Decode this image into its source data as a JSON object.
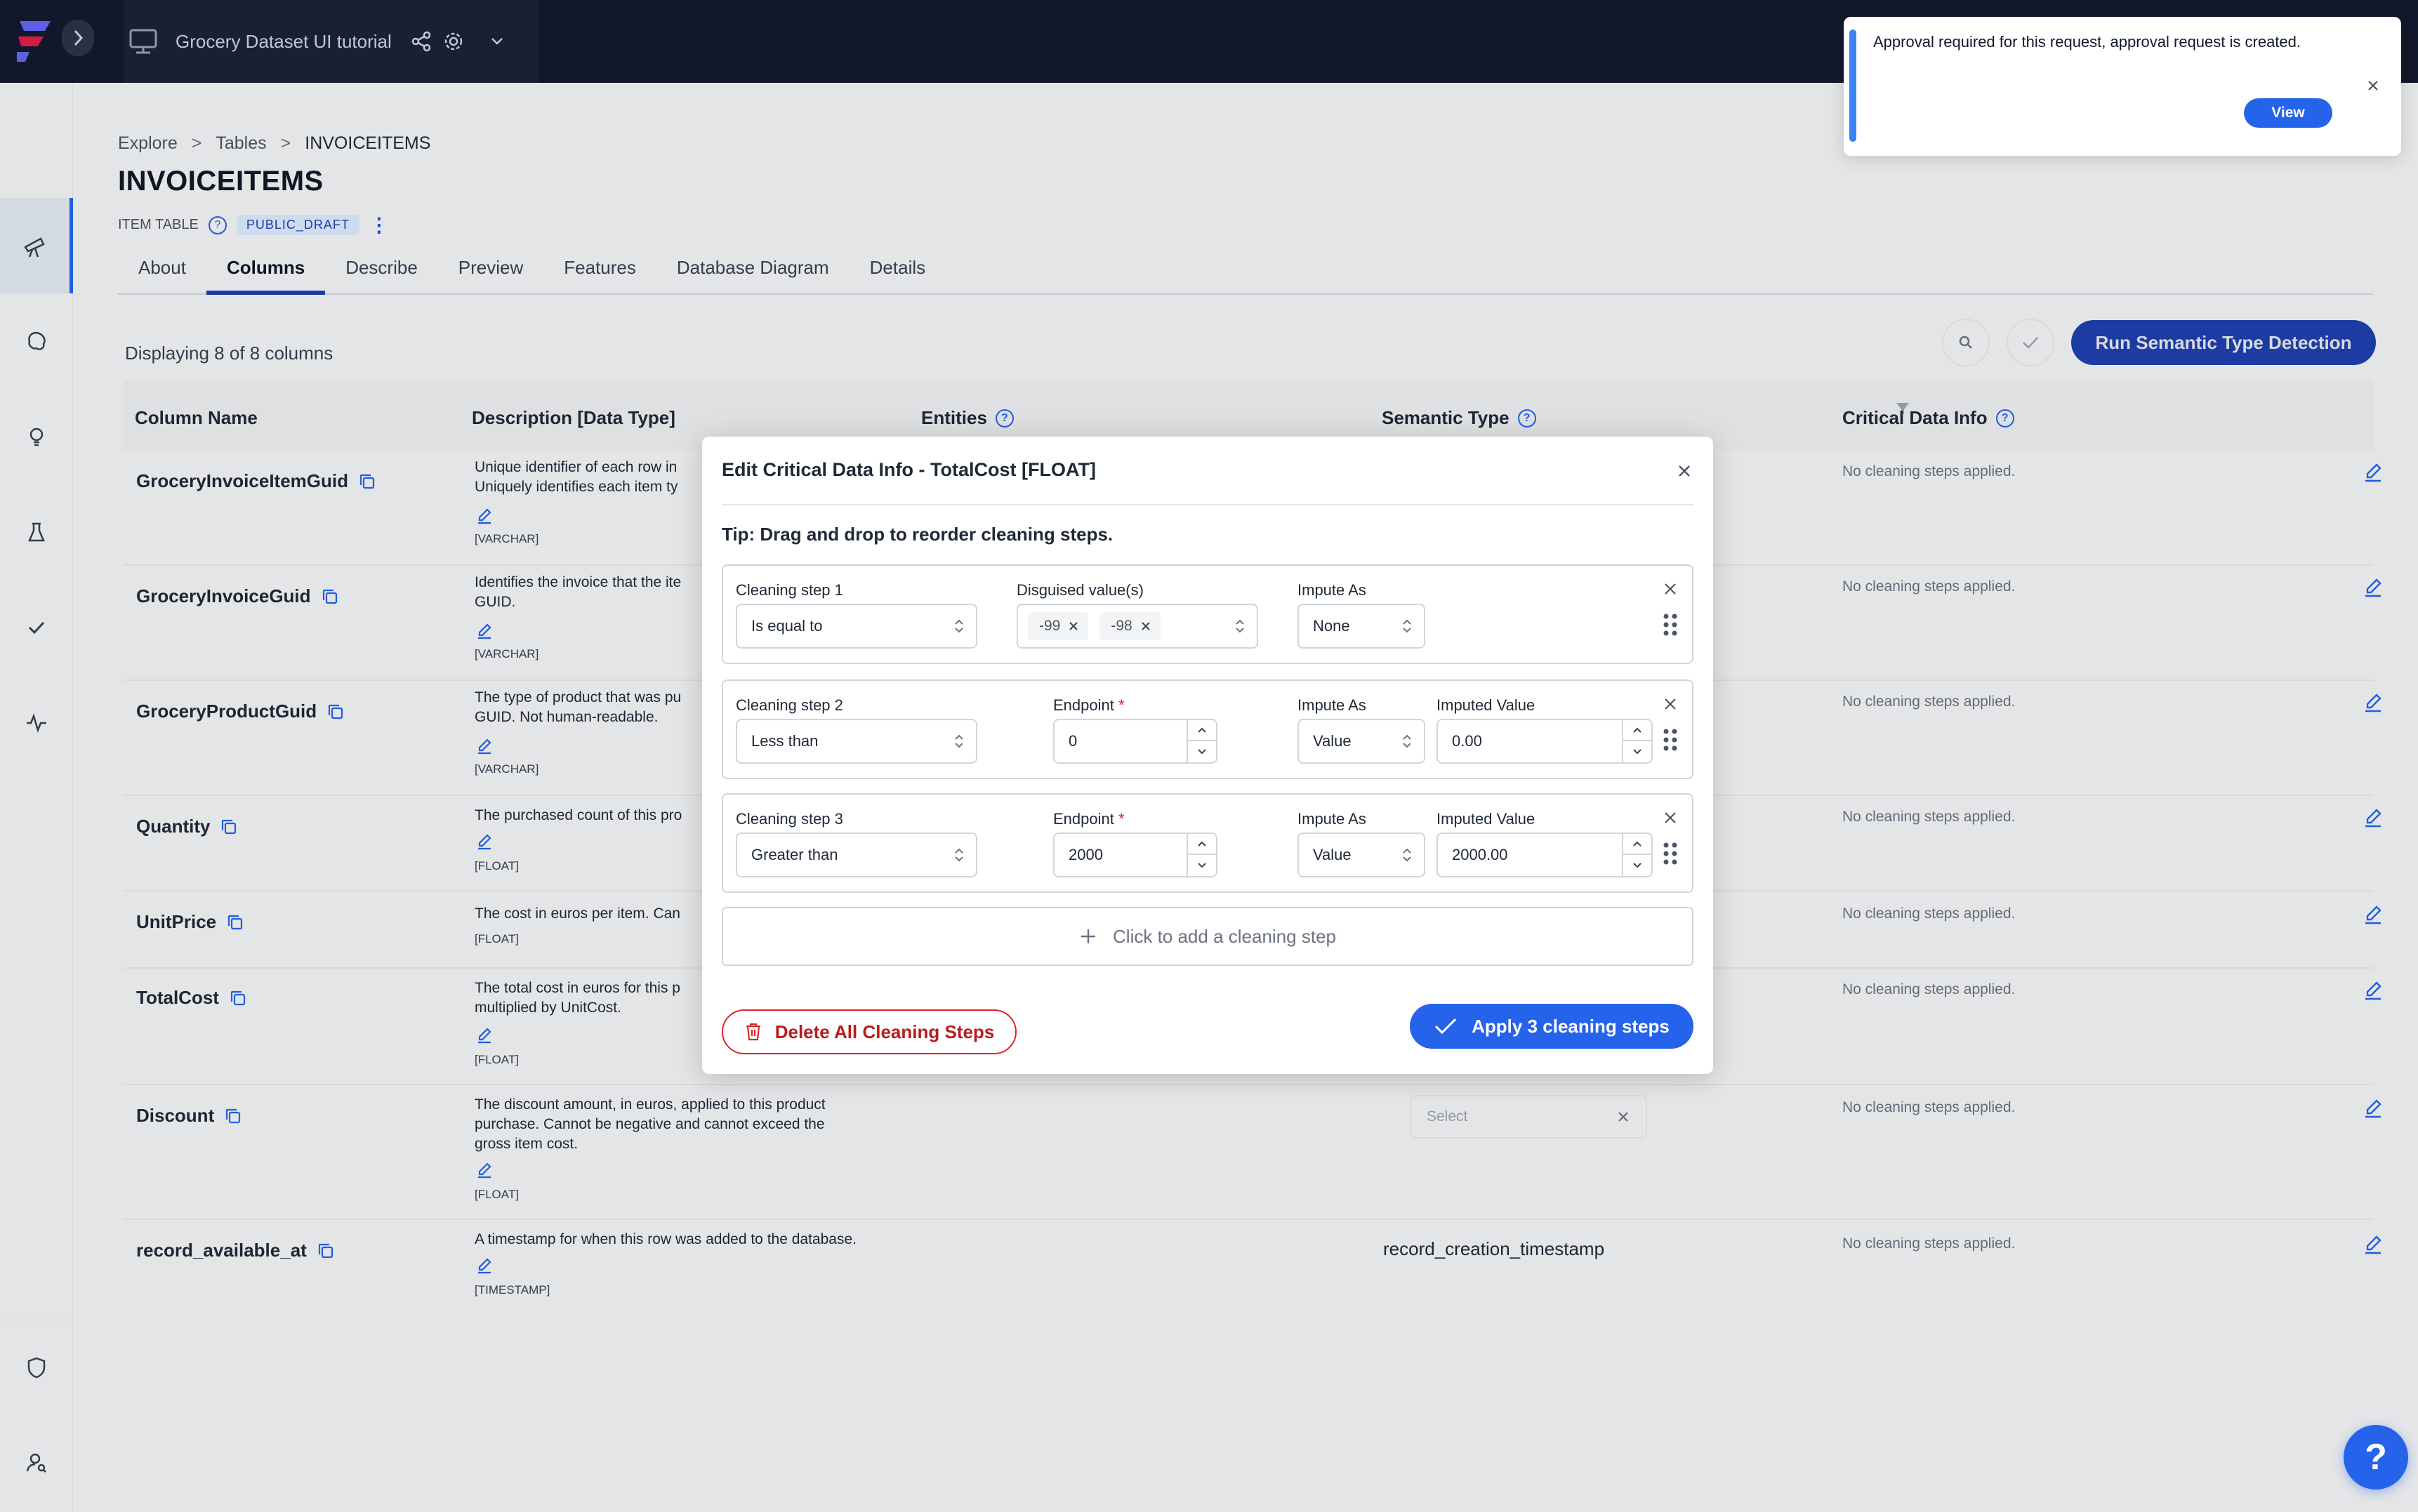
{
  "topbar": {
    "project_name": "Grocery Dataset UI tutorial",
    "brand_color": "#2563eb"
  },
  "breadcrumb": {
    "items": [
      "Explore",
      "Tables",
      "INVOICEITEMS"
    ],
    "separator": ">"
  },
  "page": {
    "title": "INVOICEITEMS",
    "item_kind": "ITEM TABLE",
    "badge": "PUBLIC_DRAFT"
  },
  "tabs": [
    "About",
    "Columns",
    "Describe",
    "Preview",
    "Features",
    "Database Diagram",
    "Details"
  ],
  "active_tab": "Columns",
  "columns_view": {
    "count_text": "Displaying 8 of 8 columns",
    "run_button": "Run Semantic Type Detection",
    "headers": {
      "column_name": "Column Name",
      "description": "Description [Data Type]",
      "entities": "Entities",
      "semantic_type": "Semantic Type",
      "critical_data_info": "Critical Data Info"
    },
    "rows": [
      {
        "name": "GroceryInvoiceItemGuid",
        "desc": "Unique identifier of each row in\nUniquely identifies each item ty",
        "dtype": "[VARCHAR]",
        "cd": "No cleaning steps applied."
      },
      {
        "name": "GroceryInvoiceGuid",
        "desc": "Identifies the invoice that the ite\nGUID.",
        "dtype": "[VARCHAR]",
        "cd": "No cleaning steps applied."
      },
      {
        "name": "GroceryProductGuid",
        "desc": "The type of product that was pu\nGUID. Not human-readable.",
        "dtype": "[VARCHAR]",
        "cd": "No cleaning steps applied."
      },
      {
        "name": "Quantity",
        "desc": "The purchased count of this pro",
        "dtype": "[FLOAT]",
        "cd": "No cleaning steps applied."
      },
      {
        "name": "UnitPrice",
        "desc": "The cost in euros per item. Can",
        "dtype": "[FLOAT]",
        "cd": "No cleaning steps applied."
      },
      {
        "name": "TotalCost",
        "desc": "The total cost in euros for this p\nmultiplied by UnitCost.",
        "dtype": "[FLOAT]",
        "cd": "No cleaning steps applied."
      },
      {
        "name": "Discount",
        "desc": "The discount amount, in euros, applied to this product\npurchase. Cannot be negative and cannot exceed the\ngross item cost.",
        "dtype": "[FLOAT]",
        "cd": "No cleaning steps applied.",
        "semantic_select_placeholder": "Select"
      },
      {
        "name": "record_available_at",
        "desc": "A timestamp for when this row was added to the database.",
        "dtype": "[TIMESTAMP]",
        "cd": "No cleaning steps applied.",
        "semantic": "record_creation_timestamp"
      }
    ]
  },
  "modal": {
    "title": "Edit Critical Data Info - TotalCost [FLOAT]",
    "tip": "Tip: Drag and drop to reorder cleaning steps.",
    "step1": {
      "label": "Cleaning step 1",
      "type": "Is equal to",
      "disguised_label": "Disguised value(s)",
      "chips": [
        "-99",
        "-98"
      ],
      "impute_label": "Impute As",
      "impute": "None"
    },
    "step2": {
      "label": "Cleaning step 2",
      "type": "Less than",
      "endpoint_label": "Endpoint",
      "endpoint": "0",
      "impute_label": "Impute As",
      "impute": "Value",
      "imputed_label": "Imputed Value",
      "imputed": "0.00"
    },
    "step3": {
      "label": "Cleaning step 3",
      "type": "Greater than",
      "endpoint_label": "Endpoint",
      "endpoint": "2000",
      "impute_label": "Impute As",
      "impute": "Value",
      "imputed_label": "Imputed Value",
      "imputed": "2000.00"
    },
    "required_mark": "*",
    "add_step": "Click to add a cleaning step",
    "delete_all": "Delete All Cleaning Steps",
    "apply": "Apply 3 cleaning steps"
  },
  "toast": {
    "message": "Approval required for this request, approval request is created.",
    "view": "View"
  },
  "help_fab": "?"
}
